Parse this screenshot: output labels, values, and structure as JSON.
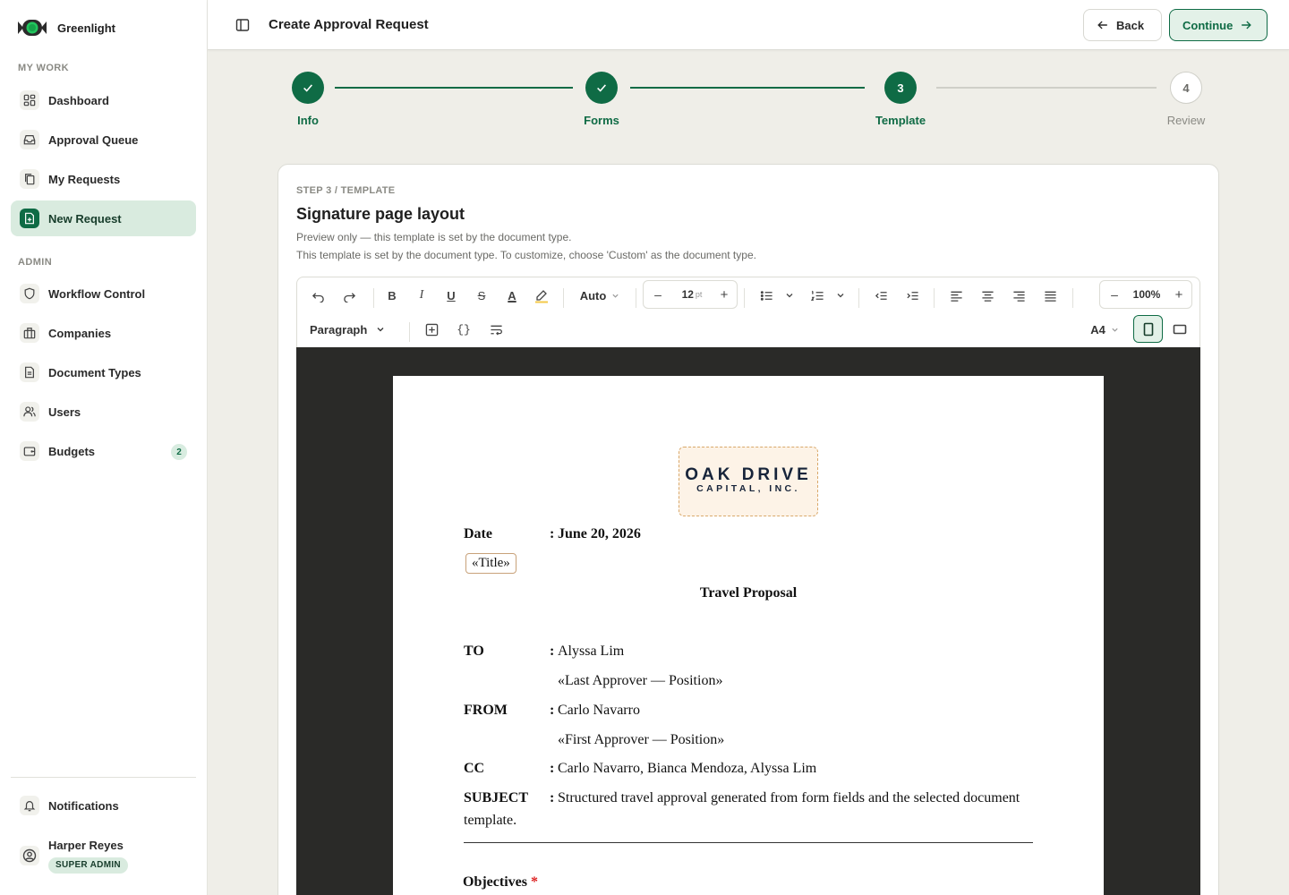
{
  "app": {
    "name": "Greenlight"
  },
  "sidebar": {
    "sections": [
      {
        "label": "MY WORK",
        "items": [
          {
            "label": "Dashboard",
            "icon": "dashboard-icon"
          },
          {
            "label": "Approval Queue",
            "icon": "inbox-icon"
          },
          {
            "label": "My Requests",
            "icon": "copy-icon"
          },
          {
            "label": "New Request",
            "icon": "file-plus-icon",
            "active": true
          }
        ]
      },
      {
        "label": "ADMIN",
        "items": [
          {
            "label": "Workflow Control",
            "icon": "shield-icon"
          },
          {
            "label": "Companies",
            "icon": "building-icon"
          },
          {
            "label": "Document Types",
            "icon": "document-icon"
          },
          {
            "label": "Users",
            "icon": "users-icon"
          },
          {
            "label": "Budgets",
            "icon": "wallet-icon",
            "badge": "2"
          }
        ]
      }
    ],
    "notifications": "Notifications",
    "user": {
      "name": "Harper Reyes",
      "role": "SUPER ADMIN"
    }
  },
  "header": {
    "title": "Create Approval Request",
    "back_label": "Back",
    "continue_label": "Continue"
  },
  "stepper": {
    "steps": [
      {
        "label": "Info",
        "number": "1",
        "state": "done"
      },
      {
        "label": "Forms",
        "number": "2",
        "state": "done"
      },
      {
        "label": "Template",
        "number": "3",
        "state": "current"
      },
      {
        "label": "Review",
        "number": "4",
        "state": "todo"
      }
    ]
  },
  "card": {
    "eyebrow": "STEP 3 / TEMPLATE",
    "title": "Signature page layout",
    "desc1": "Preview only — this template is set by the document type.",
    "desc2": "This template is set by the document type. To customize, choose 'Custom' as the document type."
  },
  "toolbar": {
    "font_color_mode": "Auto",
    "font_size": "12",
    "font_size_unit": "pt",
    "zoom": "100%",
    "block_style": "Paragraph",
    "page_size": "A4",
    "accent_color": "#0f6b45"
  },
  "document": {
    "logo_line1": "OAK DRIVE",
    "logo_line2": "CAPITAL, INC.",
    "date_label": "Date",
    "date_value": "June 20, 2026",
    "title_placeholder": "«Title»",
    "heading": "Travel Proposal",
    "to_label": "TO",
    "to_value": "Alyssa Lim",
    "to_position": "«Last Approver — Position»",
    "from_label": "FROM",
    "from_value": "Carlo Navarro",
    "from_position": "«First Approver — Position»",
    "cc_label": "CC",
    "cc_value": "Carlo Navarro, Bianca Mendoza, Alyssa Lim",
    "subject_label": "SUBJECT",
    "subject_value": "Structured travel approval generated from form fields and the selected document",
    "subject_value_cont": "template.",
    "section_heading": "Objectives",
    "required_mark": "*"
  }
}
